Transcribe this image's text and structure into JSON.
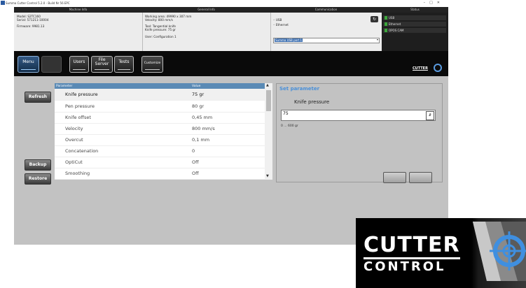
{
  "window": {
    "title": "Summa Cutter Control 5.2.0 - Build Nr 56 EPC"
  },
  "header_sections": {
    "machine": "Machine Info",
    "general": "General Info",
    "communication": "Communication",
    "status": "Status"
  },
  "machine_info": {
    "model": "Model: S2TC160",
    "serial": "Serial: 571211-10004",
    "firmware": "Firmware: 9981.13"
  },
  "general_info": {
    "working_area": "Working area: 49990 x 307 mm",
    "velocity": "Velocity: 800 mm/s",
    "tool": "Tool: Tangential knife",
    "knife_pressure": "Knife pressure: 75 gr",
    "user": "User: Configuration 1"
  },
  "communication": {
    "usb_label": "USB",
    "ethernet_label": "Ethernet",
    "port_value": "Summa USB port 1"
  },
  "status": {
    "items": [
      {
        "label": "USB",
        "color": "#3aa63a"
      },
      {
        "label": "Ethernet",
        "color": "#3aa63a"
      },
      {
        "label": "OPOS CAM",
        "color": "#3aa63a"
      }
    ]
  },
  "toolbar": {
    "menu": "Menu",
    "users": "Users",
    "file_server_1": "File",
    "file_server_2": "Server",
    "tests": "Tests",
    "customize": "Customize",
    "logo": "CUTTER"
  },
  "sidebar": {
    "refresh": "Refresh",
    "backup": "Backup",
    "restore": "Restore"
  },
  "table": {
    "col_parameter": "Parameter",
    "col_value": "Value",
    "rows": [
      {
        "parameter": "Knife pressure",
        "value": "75 gr"
      },
      {
        "parameter": "Pen pressure",
        "value": "80 gr"
      },
      {
        "parameter": "Knife offset",
        "value": "0,45 mm"
      },
      {
        "parameter": "Velocity",
        "value": "800 mm/s"
      },
      {
        "parameter": "Overcut",
        "value": "0,1 mm"
      },
      {
        "parameter": "Concatenation",
        "value": "0"
      },
      {
        "parameter": "OptiCut",
        "value": "Off"
      },
      {
        "parameter": "Smoothing",
        "value": "Off"
      }
    ]
  },
  "set_parameter": {
    "title": "Set parameter",
    "name": "Knife pressure",
    "value": "75",
    "range": "0 ... 600 gr"
  },
  "brand": {
    "line1": "CUTTER",
    "line2": "CONTROL"
  }
}
